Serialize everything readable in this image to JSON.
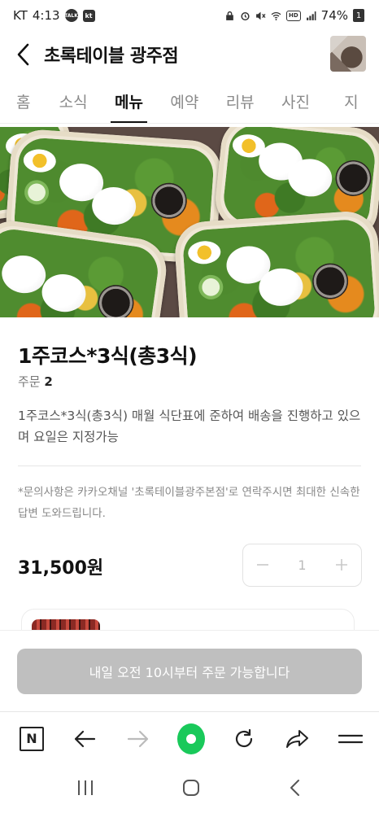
{
  "status_bar": {
    "carrier": "KT",
    "time": "4:13",
    "badge_talk": "TALK",
    "badge_kt": "kt",
    "hd_label": "HD",
    "battery_percent": "74%",
    "battery_count": "1"
  },
  "header": {
    "title": "초록테이블 광주점"
  },
  "tabs": [
    "홈",
    "소식",
    "메뉴",
    "예약",
    "리뷰",
    "사진",
    "지"
  ],
  "active_tab": "메뉴",
  "product": {
    "title": "1주코스*3식(총3식)",
    "order_label": "주문",
    "order_count": "2",
    "description": "1주코스*3식(총3식) 매월 식단표에 준하여 배송을 진행하고 있으며 요일은 지정가능",
    "notice": "*문의사항은 카카오채널 '초록테이블광주본점'로 연락주시면 최대한 신속한 답변 도와드립니다.",
    "price": "31,500원",
    "quantity": "1"
  },
  "cta": {
    "label": "내일 오전 10시부터 주문 가능합니다"
  },
  "browser_toolbar": {
    "n_label": "N"
  },
  "colors": {
    "cta_disabled": "#bfbfbf",
    "accent_green": "#19c95a"
  }
}
